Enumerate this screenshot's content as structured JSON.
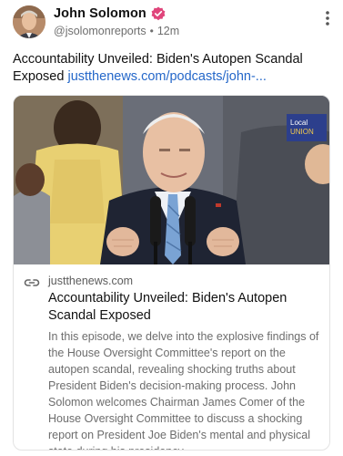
{
  "author": {
    "name": "John Solomon",
    "handle": "@jsolomonreports",
    "separator": "•",
    "time": "12m"
  },
  "post": {
    "text": "Accountability Unveiled: Biden's Autopen Scandal Exposed ",
    "link": "justthenews.com/podcasts/john-..."
  },
  "card": {
    "domain": "justthenews.com",
    "title": "Accountability Unveiled: Biden's Autopen Scandal Exposed",
    "description": "In this episode, we delve into the explosive findings of the House Oversight Committee's report on the autopen scandal, revealing shocking truths about President Biden's decision-making process. John Solomon welcomes Chairman James Comer of the House Oversight Committee to discuss a shocking report on President Joe Biden's mental and physical state during his presidency."
  },
  "icons": {
    "verified": "verified-badge-icon",
    "more": "more-vertical-icon",
    "link": "link-chain-icon"
  },
  "colors": {
    "link": "#2467c9",
    "verified": "#e0457b",
    "border": "#e3e3e3"
  }
}
